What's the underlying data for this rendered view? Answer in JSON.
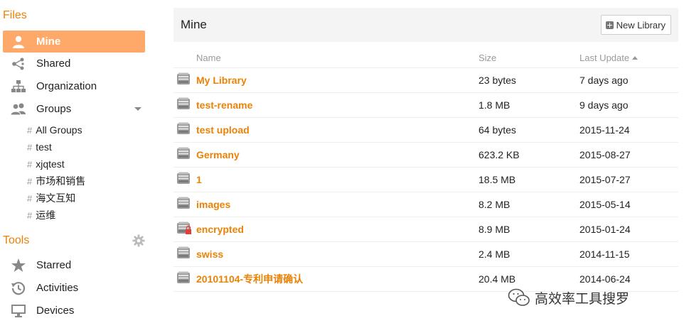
{
  "sidebar": {
    "files_title": "Files",
    "items": [
      {
        "label": "Mine",
        "icon": "user-icon",
        "active": true
      },
      {
        "label": "Shared",
        "icon": "share-icon"
      },
      {
        "label": "Organization",
        "icon": "org-tree-icon"
      },
      {
        "label": "Groups",
        "icon": "group-icon"
      }
    ],
    "groups": [
      "All Groups",
      "test",
      "xjqtest",
      "市场和销售",
      "海文互知",
      "运维"
    ],
    "group_hash": "#",
    "tools_title": "Tools",
    "tools": [
      {
        "label": "Starred",
        "icon": "star-icon"
      },
      {
        "label": "Activities",
        "icon": "history-icon"
      },
      {
        "label": "Devices",
        "icon": "monitor-icon"
      }
    ]
  },
  "main": {
    "title": "Mine",
    "new_library": "New Library",
    "columns": {
      "name": "Name",
      "size": "Size",
      "updated": "Last Update"
    },
    "rows": [
      {
        "name": "My Library",
        "size": "23 bytes",
        "updated": "7 days ago",
        "encrypted": false
      },
      {
        "name": "test-rename",
        "size": "1.8 MB",
        "updated": "9 days ago",
        "encrypted": false
      },
      {
        "name": "test upload",
        "size": "64 bytes",
        "updated": "2015-11-24",
        "encrypted": false
      },
      {
        "name": "Germany",
        "size": "623.2 KB",
        "updated": "2015-08-27",
        "encrypted": false
      },
      {
        "name": "1",
        "size": "18.5 MB",
        "updated": "2015-07-27",
        "encrypted": false
      },
      {
        "name": "images",
        "size": "8.2 MB",
        "updated": "2015-05-14",
        "encrypted": false
      },
      {
        "name": "encrypted",
        "size": "8.9 MB",
        "updated": "2015-01-24",
        "encrypted": true
      },
      {
        "name": "swiss",
        "size": "2.4 MB",
        "updated": "2014-11-15",
        "encrypted": false
      },
      {
        "name": "20101104-专利申请确认",
        "size": "20.4 MB",
        "updated": "2014-06-24",
        "encrypted": false
      }
    ]
  },
  "watermark": {
    "text": "高效率工具搜罗"
  },
  "colors": {
    "accent": "#eb8205",
    "active_bg": "#fea96a",
    "header_bg": "#f4f4f4"
  }
}
